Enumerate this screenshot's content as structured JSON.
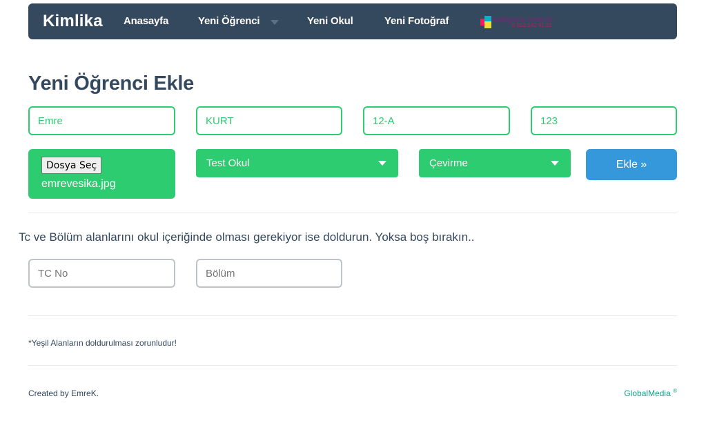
{
  "navbar": {
    "brand": "Kimlika",
    "items": [
      {
        "label": "Anasayfa"
      },
      {
        "label": "Yeni Öğrenci"
      },
      {
        "label": "Yeni Okul"
      },
      {
        "label": "Yeni Fotoğraf"
      }
    ],
    "logo_text": "ludiguru.com.tr",
    "logo_sub": "0 552 542 41 31"
  },
  "page_title": "Yeni Öğrenci Ekle",
  "form": {
    "first_name": "Emre",
    "last_name": "KURT",
    "class": "12-A",
    "number": "123",
    "file_button": "Dosya Seç",
    "file_name": "emrevesika.jpg",
    "school_select": "Test Okul",
    "type_select": "Çevirme",
    "submit": "Ekle »"
  },
  "info_text": "Tc ve Bölüm alanlarını okul içeriğinde olması gerekiyor ise doldurun. Yoksa boş bırakın..",
  "optional": {
    "tc_placeholder": "TC No",
    "department_placeholder": "Bölüm"
  },
  "note": "*Yeşil Alanların doldurulması zorunludur!",
  "footer": {
    "credit": "Created by EmreK.",
    "company": "GlobalMedia",
    "company_mark": "®"
  },
  "colors": {
    "navbar": "#34495e",
    "green": "#2ecc71",
    "blue": "#3498db",
    "footer_link": "#16a085"
  }
}
